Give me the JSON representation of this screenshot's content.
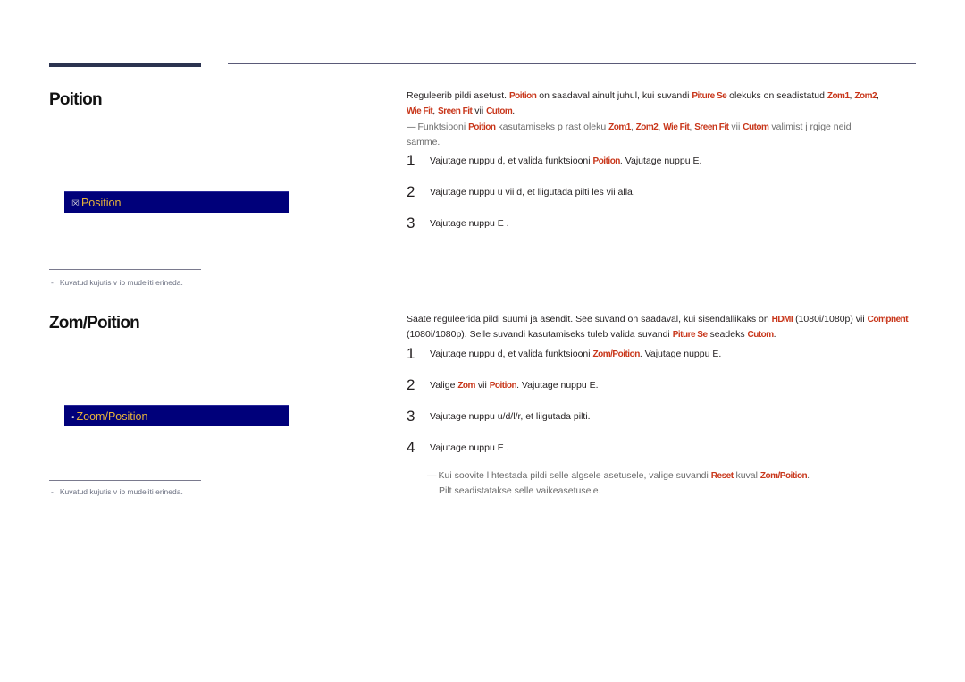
{
  "section1": {
    "title": "Poition",
    "osd_label": "Position",
    "osd_glyph": "☒",
    "footnote_dash": "-",
    "footnote": "Kuvatud kujutis v ib mudeliti erineda.",
    "intro": {
      "t1": "Reguleerib pildi asetust. ",
      "k1": "Poition",
      "t2": " on saadaval ainult juhul, kui suvandi ",
      "k2": "Piture Se",
      "t3": " olekuks on seadistatud ",
      "k3": "Zom1",
      "t4": ", ",
      "k4": "Zom2",
      "t5": ",",
      "k5": "Wie Fit",
      "t6": ", ",
      "k6": "Sreen Fit",
      "t7": " vii ",
      "k7": "Cutom",
      "t8": "."
    },
    "note": {
      "dash": "—",
      "t1": "Funktsiooni ",
      "k1": "Poition",
      "t2": " kasutamiseks p rast oleku ",
      "k2": "Zom1",
      "t3": ", ",
      "k3": "Zom2",
      "t4": ", ",
      "k4": "Wie Fit",
      "t5": ", ",
      "k5": "Sreen Fit",
      "t6": " vii ",
      "k6": "Cutom",
      "t7": " valimist j rgige neid samme."
    },
    "steps": [
      {
        "num": "1",
        "t1": "Vajutage nuppu d, et valida funktsiooni ",
        "k1": "Poition",
        "t2": ". Vajutage nuppu E."
      },
      {
        "num": "2",
        "t1": "Vajutage nuppu u vii d, et liigutada pilti  les vii alla."
      },
      {
        "num": "3",
        "t1": "Vajutage nuppu E ."
      }
    ]
  },
  "section2": {
    "title": "Zom/Poition",
    "osd_label": "Zoom/Position",
    "osd_glyph": "•",
    "footnote_dash": "-",
    "footnote": "Kuvatud kujutis v ib mudeliti erineda.",
    "intro": {
      "t1": "Saate reguleerida pildi suumi ja asendit. See suvand on saadaval, kui sisendallikaks on ",
      "k1": "HDMI",
      "t2": " (1080i/1080p) vii ",
      "k2": "Compnent",
      "t3": " (1080i/1080p). Selle suvandi kasutamiseks tuleb valida suvandi ",
      "k3": "Piture Se",
      "t4": " seadeks ",
      "k4": "Cutom",
      "t5": "."
    },
    "steps": [
      {
        "num": "1",
        "t1": "Vajutage nuppu d, et valida funktsiooni ",
        "k1": "Zom/Poition",
        "t2": ". Vajutage nuppu E."
      },
      {
        "num": "2",
        "t1": "Valige ",
        "k1": "Zom",
        "t2": " vii ",
        "k2": "Poition",
        "t3": ". Vajutage nuppu E."
      },
      {
        "num": "3",
        "t1": "Vajutage nuppu u/d/l/r, et liigutada pilti."
      },
      {
        "num": "4",
        "t1": "Vajutage nuppu E ."
      }
    ],
    "note": {
      "dash": "—",
      "t1": "Kui soovite l htestada pildi selle algsele asetusele, valige suvandi ",
      "k1": "Reset",
      "t2": " kuval ",
      "k2": "Zom/Poition",
      "t3": ".",
      "t4": "Pilt seadistatakse selle vaikeasetusele."
    }
  }
}
